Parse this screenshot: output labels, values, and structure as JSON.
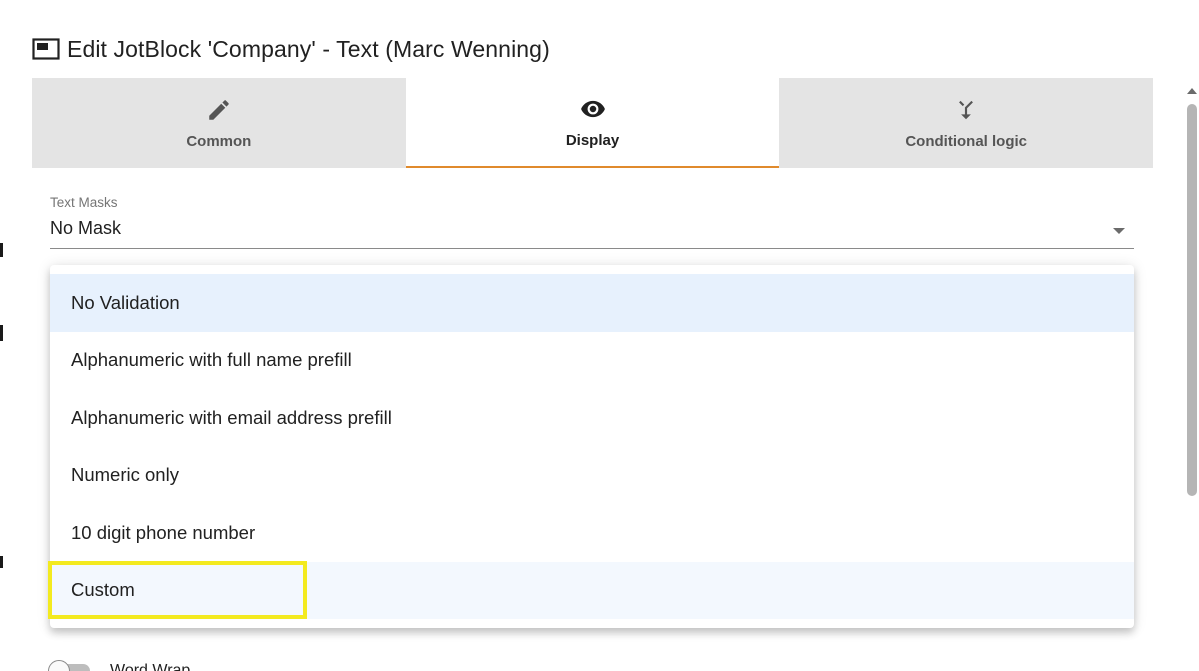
{
  "dialog": {
    "title": "Edit JotBlock 'Company' - Text (Marc Wenning)",
    "title_icon": "picture-in-picture-icon"
  },
  "tabs": [
    {
      "label": "Common",
      "icon": "pencil-icon",
      "active": false
    },
    {
      "label": "Display",
      "icon": "eye-icon",
      "active": true
    },
    {
      "label": "Conditional logic",
      "icon": "merge-arrows-icon",
      "active": false
    }
  ],
  "text_masks": {
    "label": "Text Masks",
    "value": "No Mask"
  },
  "validation_menu": {
    "items": [
      {
        "label": "No Validation",
        "state": "selected"
      },
      {
        "label": "Alphanumeric with full name prefill",
        "state": "normal"
      },
      {
        "label": "Alphanumeric with email address prefill",
        "state": "normal"
      },
      {
        "label": "Numeric only",
        "state": "normal"
      },
      {
        "label": "10 digit phone number",
        "state": "normal"
      },
      {
        "label": "Custom",
        "state": "hovered"
      }
    ]
  },
  "word_wrap": {
    "label": "Word Wrap",
    "enabled": false
  },
  "colors": {
    "active_tab_underline": "#e08a2c",
    "selected_item_bg": "#e7f1fd",
    "highlight_box": "#f3ea1f"
  }
}
